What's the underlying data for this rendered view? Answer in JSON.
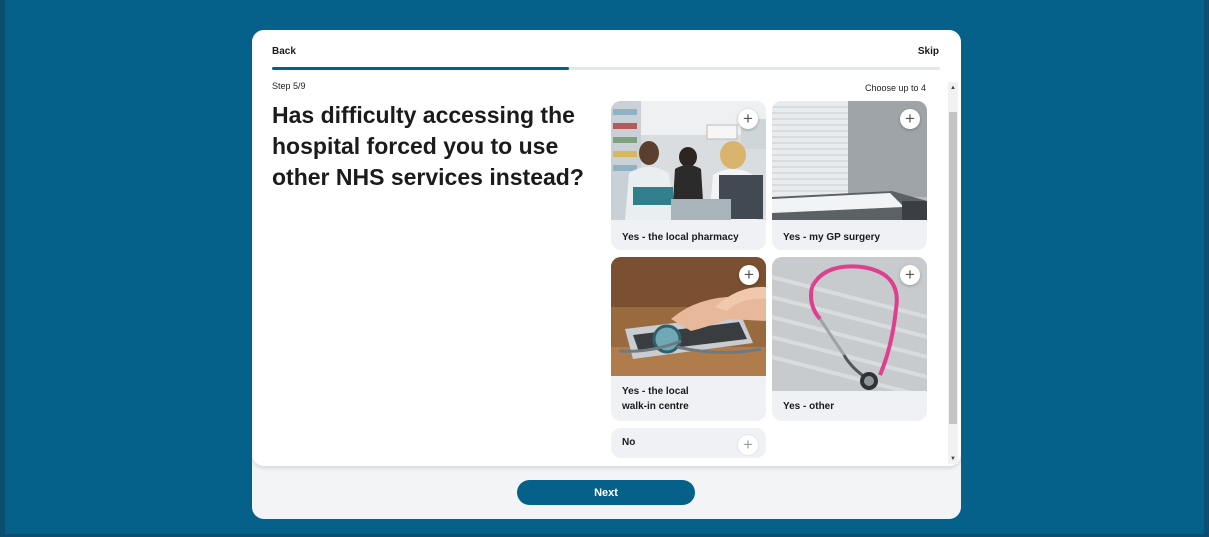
{
  "nav": {
    "back_label": "Back",
    "skip_label": "Skip"
  },
  "progress": {
    "step_text": "Step 5/9",
    "fraction": 0.4444
  },
  "question": {
    "title": "Has difficulty accessing the hospital forced you to use other NHS services instead?"
  },
  "selection_hint": "Choose up to 4",
  "options": [
    {
      "label": "Yes - the local pharmacy",
      "icon": "plus-icon"
    },
    {
      "label": "Yes - my GP surgery",
      "icon": "plus-icon"
    },
    {
      "label_line1": "Yes - the local",
      "label_line2": "walk-in centre",
      "icon": "plus-icon"
    },
    {
      "label": "Yes - other",
      "icon": "plus-icon"
    },
    {
      "label": "No",
      "icon": "plus-icon"
    }
  ],
  "footer": {
    "next_label": "Next"
  },
  "colors": {
    "brand": "#05608a",
    "card": "#ffffff",
    "option_bg": "#f0f1f4"
  }
}
